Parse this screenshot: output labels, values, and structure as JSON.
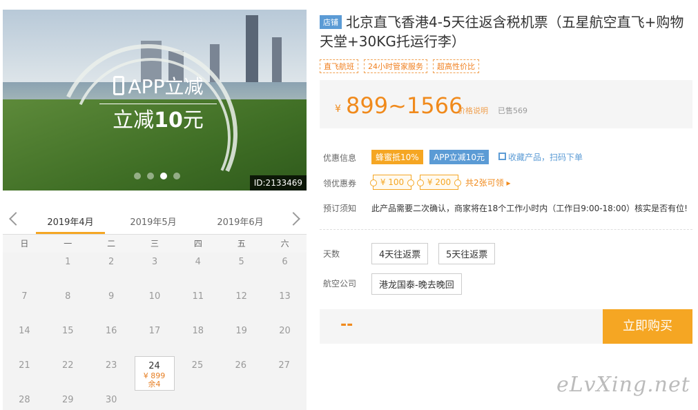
{
  "hero": {
    "promo_line1": "APP立减",
    "promo_line2_prefix": "立减",
    "promo_line2_amount": "10",
    "promo_line2_suffix": "元",
    "product_id": "ID:2133469",
    "dots": 4,
    "active_dot": 3
  },
  "calendar": {
    "months": [
      "2019年4月",
      "2019年5月",
      "2019年6月"
    ],
    "active_month": "2019年4月",
    "weekdays": [
      "日",
      "一",
      "二",
      "三",
      "四",
      "五",
      "六"
    ],
    "rows": [
      [
        "",
        "1",
        "2",
        "3",
        "4",
        "5",
        "6"
      ],
      [
        "7",
        "8",
        "9",
        "10",
        "11",
        "12",
        "13"
      ],
      [
        "14",
        "15",
        "16",
        "17",
        "18",
        "19",
        "20"
      ],
      [
        "21",
        "22",
        "23",
        "24",
        "25",
        "26",
        "27"
      ],
      [
        "28",
        "29",
        "30",
        "",
        "",
        "",
        ""
      ]
    ],
    "selected_day": "24",
    "selected_price": "¥ 899",
    "selected_stock": "余4"
  },
  "product": {
    "shop_badge": "店铺",
    "title": "北京直飞香港4-5天往返含税机票（五星航空直飞+购物天堂+30KG托运行李）",
    "tags": [
      "直飞航班",
      "24小时管家服务",
      "超高性价比"
    ],
    "currency": "¥",
    "price_range": "899~1566",
    "price_note": "价格说明",
    "sold": "已售569"
  },
  "offers": {
    "label": "优惠信息",
    "promo1": "蜂蜜抵10%",
    "promo2": "APP立减10元",
    "collect": "收藏产品，扫码下单"
  },
  "coupons": {
    "label": "领优惠券",
    "items": [
      "¥ 100",
      "¥ 200"
    ],
    "get_text": "共2张可领 ▸"
  },
  "booking": {
    "label": "预订须知",
    "text": "此产品需要二次确认，商家将在18个工作小时内（工作日9:00-18:00）核实是否有位!"
  },
  "options": {
    "days_label": "天数",
    "days": [
      "4天往返票",
      "5天往返票"
    ],
    "airline_label": "航空公司",
    "airline": "港龙国泰-晚去晚回"
  },
  "buy": {
    "price_placeholder": "--",
    "button": "立即购买"
  },
  "watermark": "eLvXing.net",
  "colors": {
    "accent": "#f5a623",
    "price": "#f08a1c",
    "blue": "#5b9bd5"
  }
}
